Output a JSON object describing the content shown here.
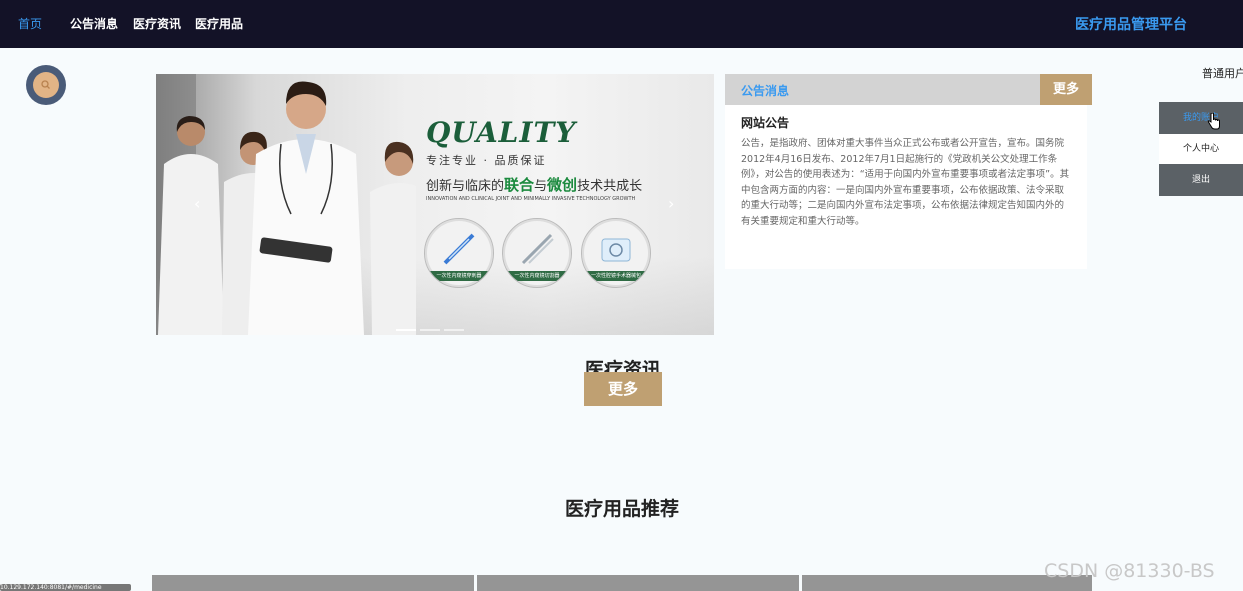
{
  "nav": {
    "home": "首页",
    "notices": "公告消息",
    "news": "医疗资讯",
    "products": "医疗用品",
    "brand": "医疗用品管理平台"
  },
  "user": {
    "label": "普通用户",
    "menu": [
      "我的账户",
      "个人中心",
      "退出"
    ]
  },
  "banner": {
    "headline": "QUALITY",
    "slogan1": "专注专业 · 品质保证",
    "slogan2_a": "创新与临床的",
    "slogan2_b": "联合",
    "slogan2_c": "与",
    "slogan2_d": "微创",
    "slogan2_e": "技术共成长",
    "slogan3": "INNOVATION AND CLINICAL JOINT AND MINIMALLY INVASIVE TECHNOLOGY GROWTH",
    "products": [
      "一次性内窥镜穿刺器",
      "一次性内窥镜切割器",
      "一次性腔镜手术器械包"
    ],
    "prev": "‹",
    "next": "›"
  },
  "notice": {
    "title": "公告消息",
    "more": "更多",
    "subtitle": "网站公告",
    "body": "公告，是指政府、团体对重大事件当众正式公布或者公开宣告，宣布。国务院2012年4月16日发布、2012年7月1日起施行的《党政机关公文处理工作条例》，对公告的使用表述为：“适用于向国内外宣布重要事项或者法定事项”。其中包含两方面的内容：一是向国内外宣布重要事项，公布依据政策、法令采取的重大行动等；二是向国内外宣布法定事项，公布依据法律规定告知国内外的有关重要规定和重大行动等。"
  },
  "news": {
    "title": "医疗资讯",
    "more": "更多"
  },
  "recommend": {
    "title": "医疗用品推荐"
  },
  "watermark": "CSDN @81330-BS",
  "statusbar": "10.129.172.140:8081/#/medicine"
}
